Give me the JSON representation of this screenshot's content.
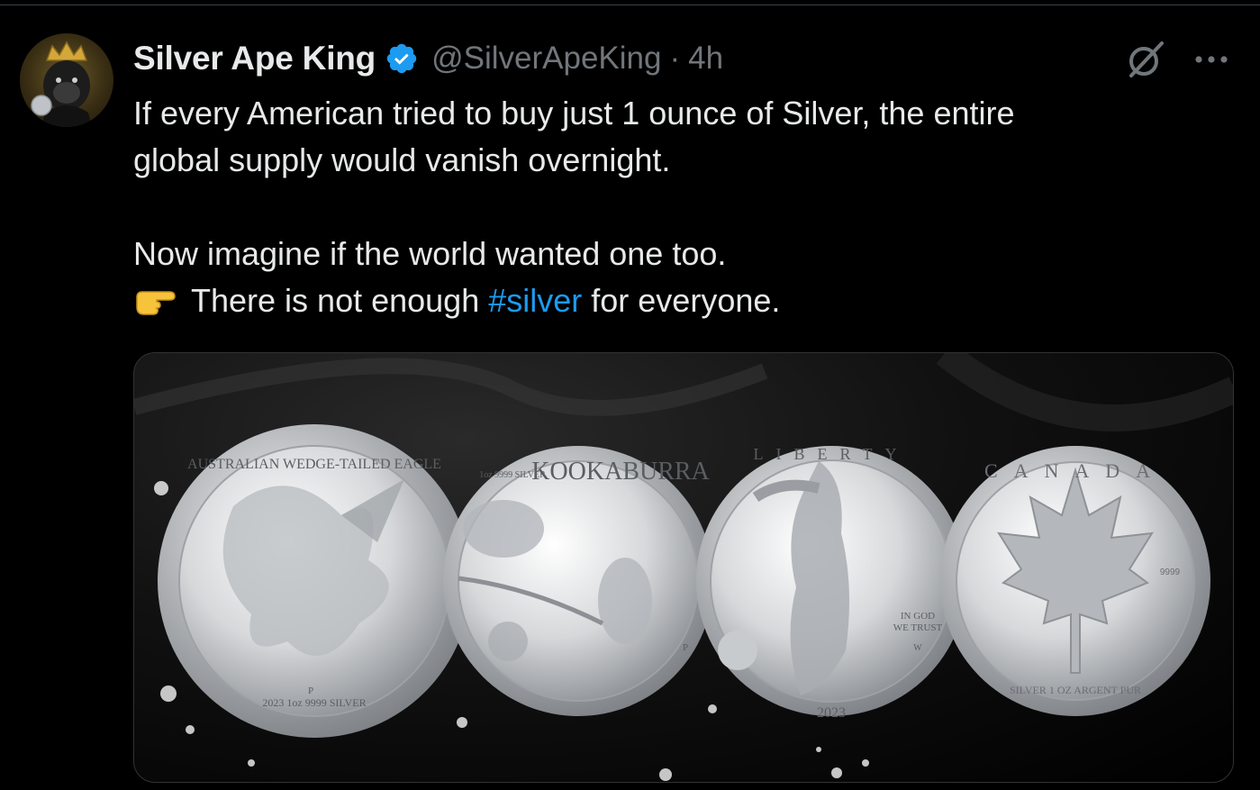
{
  "tweet": {
    "display_name": "Silver Ape King",
    "handle": "@SilverApeKing",
    "separator": "·",
    "time": "4h",
    "text_line1": "If every American tried to buy just 1 ounce of Silver, the entire",
    "text_line2": "global supply would vanish overnight.",
    "text_line3": "Now imagine if the world wanted one too.",
    "text_line4_before": "There is not enough ",
    "hashtag": "#silver",
    "text_line4_after": " for everyone."
  },
  "media": {
    "coin1_top": "AUSTRALIAN WEDGE-TAILED EAGLE",
    "coin1_bottom": "2023 1oz 9999 SILVER",
    "coin1_mint": "P",
    "coin2_title": "KOOKABURRA",
    "coin2_weight": "1oz 9999 SILVER",
    "coin2_mint": "P",
    "coin3_letters": "LIBERTY",
    "coin3_motto1": "IN GOD",
    "coin3_motto2": "WE TRUST",
    "coin3_mint": "W",
    "coin3_year": "2023",
    "coin4_top": "CANADA",
    "coin4_fine": "9999",
    "coin4_bottom": "SILVER 1 OZ ARGENT PUR"
  },
  "colors": {
    "background": "#000000",
    "text": "#e7e9ea",
    "muted": "#71767b",
    "link": "#1d9bf0",
    "verified": "#1d9bf0"
  },
  "icons": [
    "verified-badge-icon",
    "grok-icon",
    "more-icon",
    "pointing-right-icon"
  ]
}
